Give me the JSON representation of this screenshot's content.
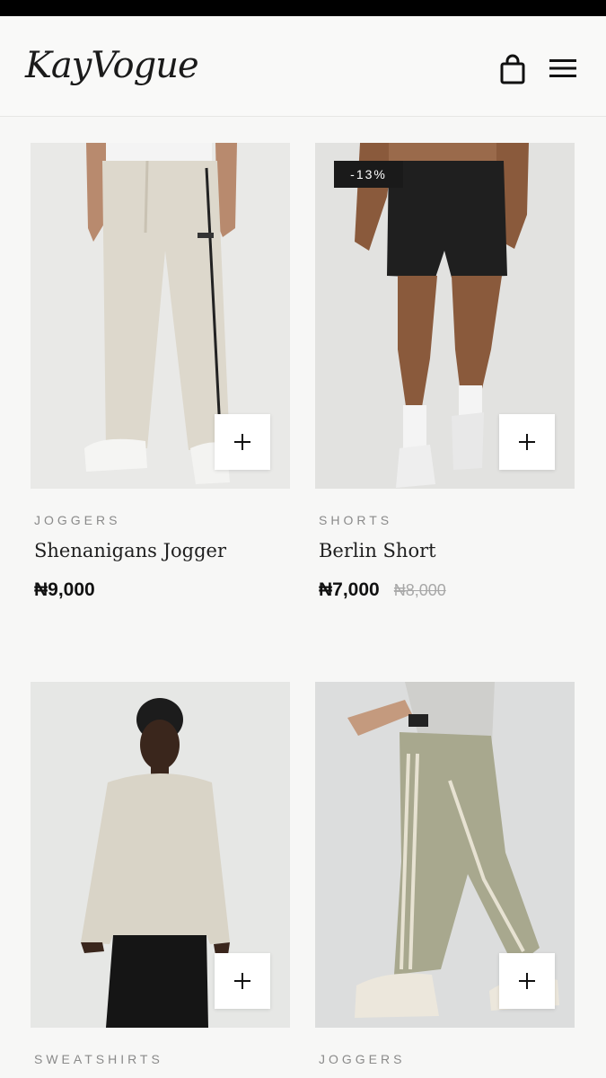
{
  "header": {
    "logo": "KayVogue",
    "icons": [
      "shopping-bag-icon",
      "menu-icon"
    ]
  },
  "products": [
    {
      "category": "JOGGERS",
      "name": "Shenanigans Jogger",
      "price": "₦9,000",
      "old_price": "",
      "badge": "",
      "image_bg": "#e9e9e7"
    },
    {
      "category": "SHORTS",
      "name": "Berlin Short",
      "price": "₦7,000",
      "old_price": "₦8,000",
      "badge": "-13%",
      "image_bg": "#e2e2e0"
    },
    {
      "category": "SWEATSHIRTS",
      "name": "",
      "price": "",
      "old_price": "",
      "badge": "",
      "image_bg": "#e6e7e5"
    },
    {
      "category": "JOGGERS",
      "name": "",
      "price": "",
      "old_price": "",
      "badge": "",
      "image_bg": "#dcdddd"
    }
  ],
  "add_icon": "plus-icon",
  "colors": {
    "accent": "#1a1a1a",
    "muted": "#8a8a8a",
    "page_bg": "#f7f7f6"
  }
}
